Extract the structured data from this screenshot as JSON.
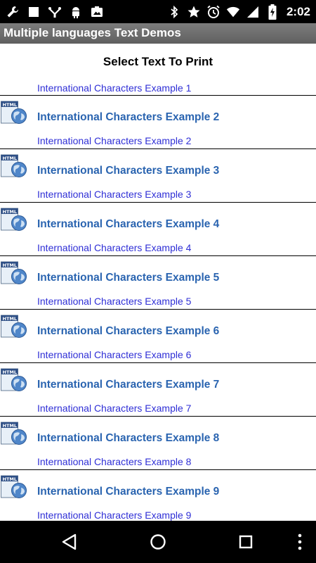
{
  "status_bar": {
    "left_icons": [
      "wrench-icon",
      "square-icon",
      "usb-icon",
      "android-icon",
      "photo-icon"
    ],
    "right_icons": [
      "bluetooth-icon",
      "star-icon",
      "alarm-icon",
      "wifi-icon",
      "signal-icon",
      "battery-icon"
    ],
    "time": "2:02"
  },
  "action_bar": {
    "title": "Multiple languages Text Demos"
  },
  "main": {
    "heading": "Select Text To Print",
    "first_item": {
      "link": "International Characters Example 1"
    },
    "items": [
      {
        "title": "International Characters Example 2",
        "link": "International Characters Example 2"
      },
      {
        "title": "International Characters Example 3",
        "link": "International Characters Example 3"
      },
      {
        "title": "International Characters Example 4",
        "link": "International Characters Example 4"
      },
      {
        "title": "International Characters Example 5",
        "link": "International Characters Example 5"
      },
      {
        "title": "International Characters Example 6",
        "link": "International Characters Example 6"
      },
      {
        "title": "International Characters Example 7",
        "link": "International Characters Example 7"
      },
      {
        "title": "International Characters Example 8",
        "link": "International Characters Example 8"
      },
      {
        "title": "International Characters Example 9",
        "link": "International Characters Example 9"
      }
    ],
    "item_icon": "html-file-icon",
    "icon_label": "HTML"
  },
  "nav_bar": {
    "buttons": [
      "back-icon",
      "home-icon",
      "recents-icon",
      "more-icon"
    ]
  },
  "colors": {
    "link": "#2f2fd6",
    "title": "#2a64b0",
    "action_bar": "#6e6e6e",
    "status_bar": "#000000"
  }
}
